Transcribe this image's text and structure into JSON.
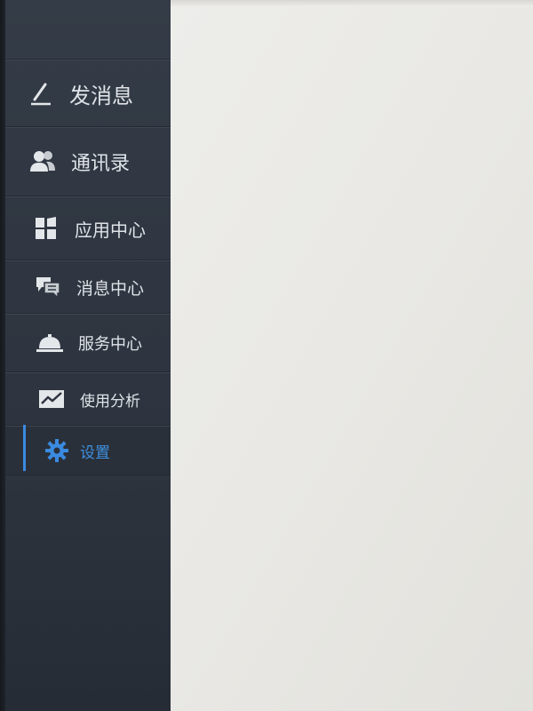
{
  "sidebar": {
    "items": [
      {
        "label": "发消息",
        "icon": "compose-icon"
      },
      {
        "label": "通讯录",
        "icon": "contacts-icon"
      },
      {
        "label": "应用中心",
        "icon": "apps-icon"
      },
      {
        "label": "消息中心",
        "icon": "messages-icon"
      },
      {
        "label": "服务中心",
        "icon": "service-bell-icon"
      },
      {
        "label": "使用分析",
        "icon": "analytics-icon"
      },
      {
        "label": "设置",
        "icon": "gear-icon",
        "active": true
      }
    ]
  },
  "colors": {
    "sidebar_bg": "#2f3641",
    "text": "#dfe3e8",
    "accent": "#3a8ae0",
    "content_bg": "#ebeae6"
  }
}
